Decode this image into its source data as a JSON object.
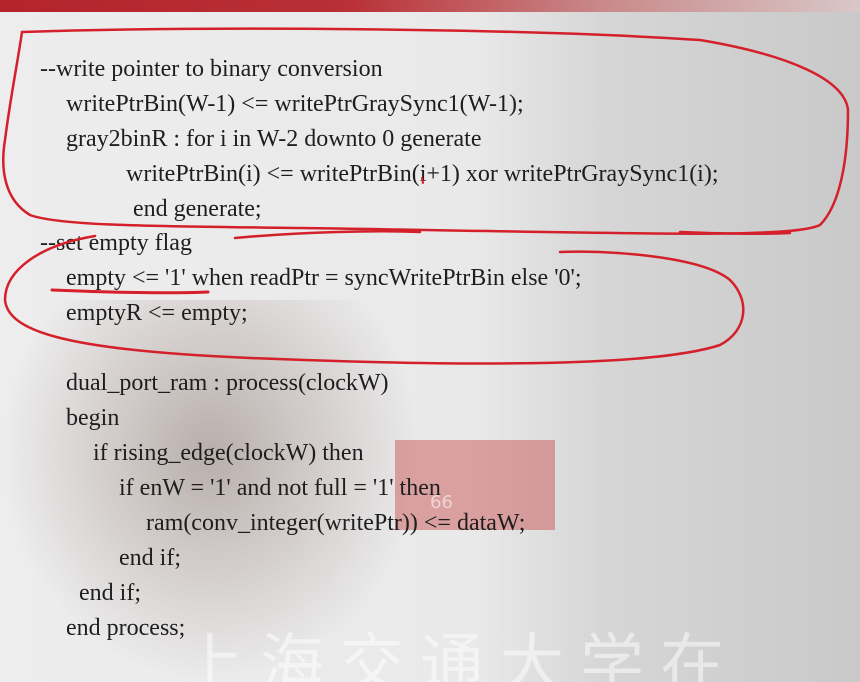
{
  "slide": {
    "code_lines": [
      "--write pointer to binary conversion",
      "writePtrBin(W-1) <= writePtrGraySync1(W-1);",
      "gray2binR : for i in W-2 downto 0 generate",
      "writePtrBin(i) <= writePtrBin(i+1) xor writePtrGraySync1(i);",
      "end generate;",
      "--set empty flag",
      "empty <= '1' when readPtr = syncWritePtrBin else '0';",
      "emptyR <= empty;",
      "dual_port_ram : process(clockW)",
      "begin",
      "if rising_edge(clockW) then",
      "if enW = '1' and not full = '1' then",
      "ram(conv_integer(writePtr)) <= dataW;",
      "end if;",
      "end if;",
      "end process;"
    ],
    "watermark": "上海交通大学在",
    "sign_number": "66"
  },
  "colors": {
    "ink": "#d4202a",
    "text": "#1e1e1e",
    "top_bar": "#b3242b"
  }
}
